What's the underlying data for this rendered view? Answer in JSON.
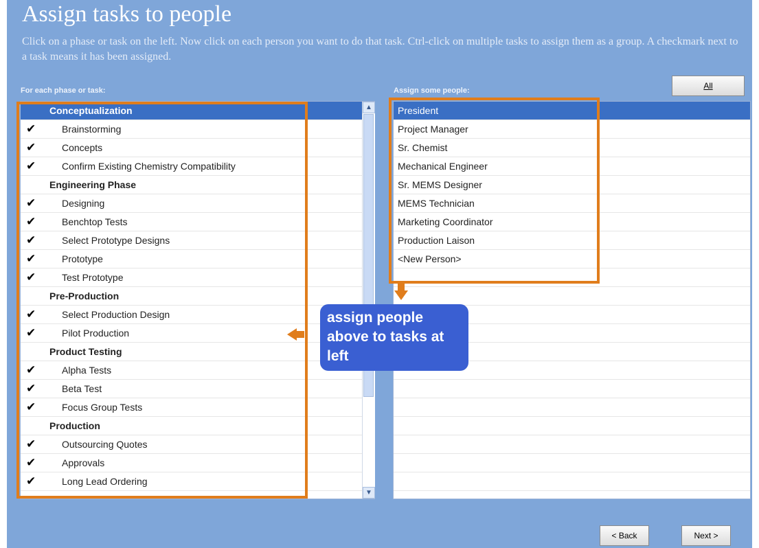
{
  "header": {
    "title": "Assign tasks to people",
    "instructions": "Click on a phase or task on the left. Now click on each person you want to do that task. Ctrl-click on multiple tasks to assign them as a group. A checkmark next to a task means it has been assigned."
  },
  "tasks": {
    "label": "For each phase or task:",
    "items": [
      {
        "text": "Conceptualization",
        "kind": "phase",
        "check": "",
        "selected": true
      },
      {
        "text": "Brainstorming",
        "kind": "task",
        "check": "✔"
      },
      {
        "text": "Concepts",
        "kind": "task",
        "check": "✔"
      },
      {
        "text": "Confirm Existing Chemistry Compatibility",
        "kind": "task",
        "check": "✔"
      },
      {
        "text": "Engineering Phase",
        "kind": "phase",
        "check": ""
      },
      {
        "text": "Designing",
        "kind": "task",
        "check": "✔"
      },
      {
        "text": "Benchtop Tests",
        "kind": "task",
        "check": "✔"
      },
      {
        "text": "Select Prototype Designs",
        "kind": "task",
        "check": "✔"
      },
      {
        "text": "Prototype",
        "kind": "task",
        "check": "✔"
      },
      {
        "text": "Test Prototype",
        "kind": "task",
        "check": "✔"
      },
      {
        "text": "Pre-Production",
        "kind": "phase",
        "check": ""
      },
      {
        "text": "Select Production Design",
        "kind": "task",
        "check": "✔"
      },
      {
        "text": "Pilot Production",
        "kind": "task",
        "check": "✔"
      },
      {
        "text": "Product Testing",
        "kind": "phase",
        "check": ""
      },
      {
        "text": "Alpha Tests",
        "kind": "task",
        "check": "✔"
      },
      {
        "text": "Beta Test",
        "kind": "task",
        "check": "✔"
      },
      {
        "text": "Focus Group Tests",
        "kind": "task",
        "check": "✔"
      },
      {
        "text": "Production",
        "kind": "phase",
        "check": ""
      },
      {
        "text": "Outsourcing Quotes",
        "kind": "task",
        "check": "✔"
      },
      {
        "text": "Approvals",
        "kind": "task",
        "check": "✔"
      },
      {
        "text": "Long Lead Ordering",
        "kind": "task",
        "check": "✔"
      }
    ]
  },
  "people": {
    "label": "Assign some people:",
    "all_button": "All",
    "items": [
      {
        "text": "President",
        "selected": true
      },
      {
        "text": "Project Manager"
      },
      {
        "text": "Sr. Chemist"
      },
      {
        "text": "Mechanical Engineer"
      },
      {
        "text": "Sr. MEMS Designer"
      },
      {
        "text": "MEMS Technician"
      },
      {
        "text": "Marketing Coordinator"
      },
      {
        "text": "Production Laison"
      },
      {
        "text": "<New Person>"
      }
    ],
    "empty_rows": 12
  },
  "callout": {
    "text": "assign people above to tasks at left"
  },
  "footer": {
    "back_label": "< Back",
    "next_label": "Next >"
  },
  "colors": {
    "background": "#7fa6d9",
    "selection": "#3a6fc4",
    "highlight": "#e07d1c",
    "callout": "#3a5fd2"
  }
}
